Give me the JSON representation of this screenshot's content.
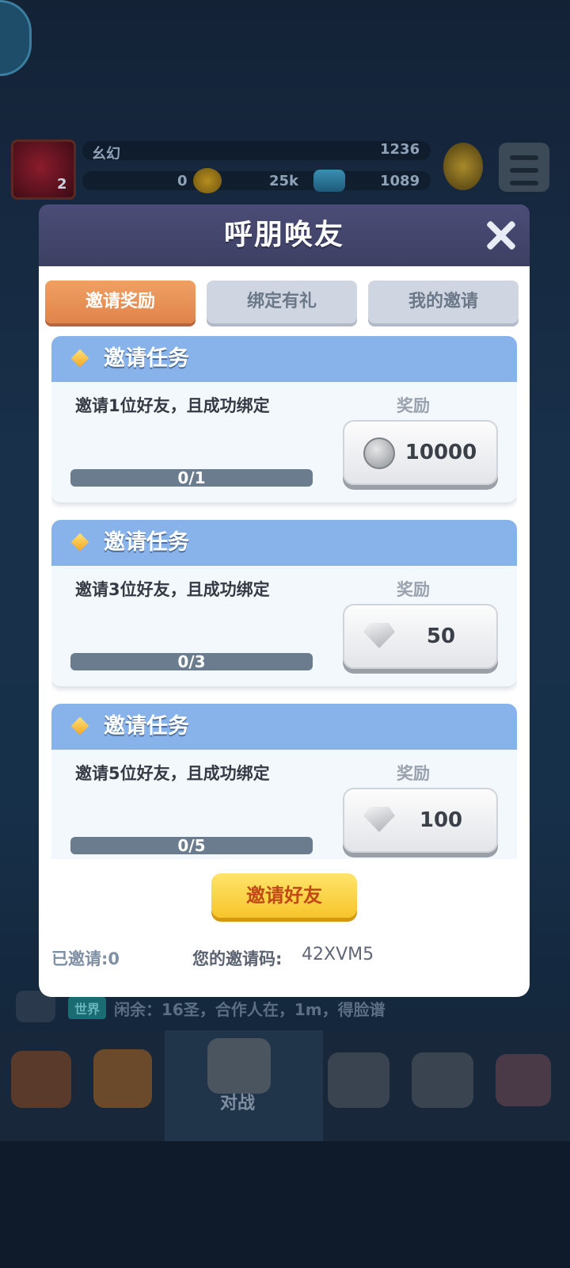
{
  "hud": {
    "player_name": "幺幻",
    "level": "2",
    "trophies": "1236",
    "resource_zero": "0",
    "coins": "25k",
    "gems": "1089"
  },
  "chat": {
    "channel": "世界",
    "message": "闲余：16圣，合作人在，1m，得脸谱"
  },
  "nav": {
    "battle_label": "对战"
  },
  "modal": {
    "title": "呼朋唤友",
    "tabs": [
      {
        "label": "邀请奖励",
        "active": true
      },
      {
        "label": "绑定有礼",
        "active": false
      },
      {
        "label": "我的邀请",
        "active": false
      }
    ],
    "tasks": [
      {
        "title": "邀请任务",
        "description": "邀请1位好友，且成功绑定",
        "reward_label": "奖励",
        "progress": "0/1",
        "reward_icon": "coin-icon",
        "reward_value": "10000"
      },
      {
        "title": "邀请任务",
        "description": "邀请3位好友，且成功绑定",
        "reward_label": "奖励",
        "progress": "0/3",
        "reward_icon": "gem-icon",
        "reward_value": "50"
      },
      {
        "title": "邀请任务",
        "description": "邀请5位好友，且成功绑定",
        "reward_label": "奖励",
        "progress": "0/5",
        "reward_icon": "gem-icon",
        "reward_value": "100"
      }
    ],
    "invite_button": "邀请好友",
    "invited_text": "已邀请:0",
    "invite_code_label": "您的邀请码:",
    "invite_code": "42XVM5"
  },
  "colors": {
    "tab_active": "#e58a50",
    "task_header": "#87b3ea",
    "invite_button": "#f7c52c"
  }
}
